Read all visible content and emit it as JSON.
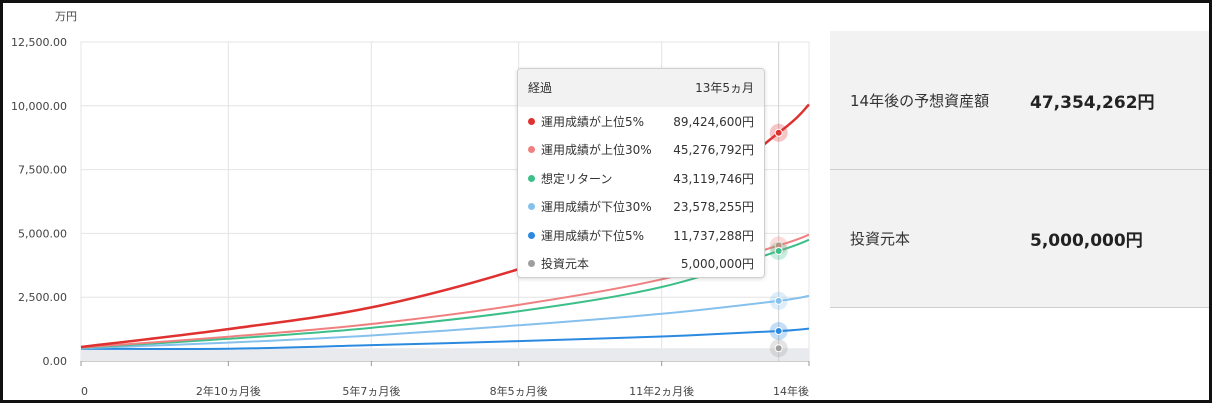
{
  "chart_data": {
    "type": "line",
    "unit_label": "万円",
    "ylim": [
      0,
      12500
    ],
    "xlim": [
      0,
      168
    ],
    "y_ticks": [
      "12,500.00",
      "10,000.00",
      "7,500.00",
      "5,000.00",
      "2,500.00",
      "0.00"
    ],
    "y_tick_values": [
      12500,
      10000,
      7500,
      5000,
      2500,
      0
    ],
    "x_ticks": [
      "0",
      "2年10ヵ月後",
      "5年7ヵ月後",
      "8年5ヵ月後",
      "11年2ヵ月後",
      "14年後"
    ],
    "x_tick_values": [
      0,
      34,
      67,
      101,
      134,
      168
    ],
    "grid": true,
    "hover_month": 161,
    "series": [
      {
        "name": "運用成績が上位5%",
        "color": "#e03131",
        "points": [
          [
            0,
            550
          ],
          [
            34,
            1250
          ],
          [
            67,
            2100
          ],
          [
            101,
            3600
          ],
          [
            134,
            5600
          ],
          [
            161,
            8942
          ],
          [
            168,
            10050
          ]
        ]
      },
      {
        "name": "運用成績が上位30%",
        "color": "#f08080",
        "points": [
          [
            0,
            530
          ],
          [
            34,
            950
          ],
          [
            67,
            1450
          ],
          [
            101,
            2200
          ],
          [
            134,
            3200
          ],
          [
            161,
            4528
          ],
          [
            168,
            4950
          ]
        ]
      },
      {
        "name": "想定リターン",
        "color": "#3dbf8a",
        "points": [
          [
            0,
            520
          ],
          [
            34,
            870
          ],
          [
            67,
            1300
          ],
          [
            101,
            1950
          ],
          [
            134,
            2900
          ],
          [
            161,
            4312
          ],
          [
            168,
            4750
          ]
        ]
      },
      {
        "name": "運用成績が下位30%",
        "color": "#85c1ec",
        "points": [
          [
            0,
            500
          ],
          [
            34,
            720
          ],
          [
            67,
            1000
          ],
          [
            101,
            1400
          ],
          [
            134,
            1850
          ],
          [
            161,
            2358
          ],
          [
            168,
            2550
          ]
        ]
      },
      {
        "name": "運用成績が下位5%",
        "color": "#2b8ae0",
        "points": [
          [
            0,
            480
          ],
          [
            34,
            480
          ],
          [
            67,
            620
          ],
          [
            101,
            780
          ],
          [
            134,
            960
          ],
          [
            161,
            1174
          ],
          [
            168,
            1270
          ]
        ]
      },
      {
        "name": "投資元本",
        "color": "#9e9e9e",
        "points": [
          [
            0,
            500
          ],
          [
            168,
            500
          ]
        ]
      }
    ]
  },
  "tooltip": {
    "header_label": "経過",
    "header_value": "13年5ヵ月",
    "rows": [
      {
        "label": "運用成績が上位5%",
        "value": "89,424,600円",
        "color": "#e03131"
      },
      {
        "label": "運用成績が上位30%",
        "value": "45,276,792円",
        "color": "#f08080"
      },
      {
        "label": "想定リターン",
        "value": "43,119,746円",
        "color": "#3dbf8a"
      },
      {
        "label": "運用成績が下位30%",
        "value": "23,578,255円",
        "color": "#85c1ec"
      },
      {
        "label": "運用成績が下位5%",
        "value": "11,737,288円",
        "color": "#2b8ae0"
      },
      {
        "label": "投資元本",
        "value": "5,000,000円",
        "color": "#9e9e9e"
      }
    ]
  },
  "summary": {
    "forecast_label": "14年後の予想資産額",
    "forecast_value": "47,354,262円",
    "principal_label": "投資元本",
    "principal_value": "5,000,000円"
  }
}
